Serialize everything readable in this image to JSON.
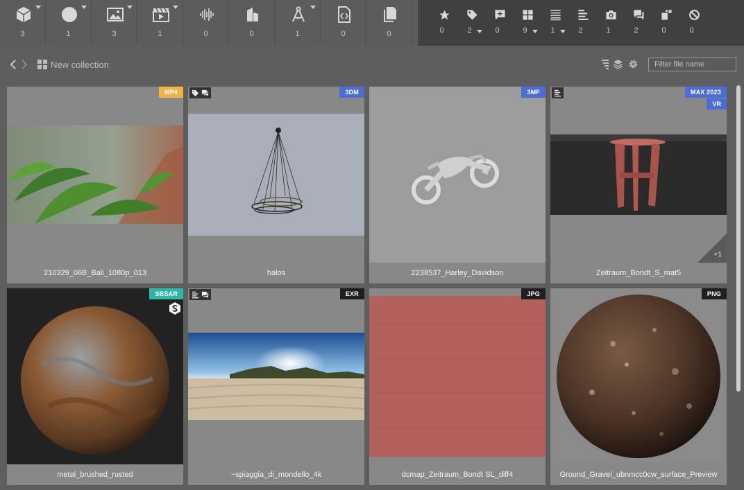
{
  "type_toolbar": [
    {
      "icon": "cube-3d-icon",
      "count": "3",
      "dropdown": true
    },
    {
      "icon": "sphere-material-icon",
      "count": "1",
      "dropdown": true
    },
    {
      "icon": "image-icon",
      "count": "3",
      "dropdown": true
    },
    {
      "icon": "video-clapper-icon",
      "count": "1",
      "dropdown": true
    },
    {
      "icon": "audio-wave-icon",
      "count": "0",
      "dropdown": false
    },
    {
      "icon": "buildings-icon",
      "count": "0",
      "dropdown": false
    },
    {
      "icon": "compass-drafting-icon",
      "count": "1",
      "dropdown": true
    },
    {
      "icon": "code-file-icon",
      "count": "0",
      "dropdown": false
    },
    {
      "icon": "documents-icon",
      "count": "0",
      "dropdown": false
    }
  ],
  "filter_toolbar": [
    {
      "icon": "star-icon",
      "count": "0",
      "dropdown": false
    },
    {
      "icon": "tag-icon",
      "count": "2",
      "dropdown": true
    },
    {
      "icon": "add-comment-icon",
      "count": "0",
      "dropdown": false
    },
    {
      "icon": "grid-layout-icon",
      "count": "9",
      "dropdown": true
    },
    {
      "icon": "list-lines-icon",
      "count": "1",
      "dropdown": true
    },
    {
      "icon": "align-left-icon",
      "count": "2",
      "dropdown": false
    },
    {
      "icon": "camera-icon",
      "count": "1",
      "dropdown": false
    },
    {
      "icon": "comments-icon",
      "count": "2",
      "dropdown": false
    },
    {
      "icon": "missing-preview-icon",
      "count": "0",
      "dropdown": false
    },
    {
      "icon": "blocked-icon",
      "count": "0",
      "dropdown": false
    }
  ],
  "path": {
    "collection_title": "New collection",
    "filter_placeholder": "Filter file name"
  },
  "colors": {
    "mp4": "#f0b443",
    "3d": "#4a6ed6",
    "sbsar": "#2fb7a6",
    "dark": "#1f1f1f"
  },
  "cards": [
    {
      "name": "210329_06B_Bali_1080p_013",
      "badge": "MP4",
      "badge_color": "#f0b443",
      "badge2": "",
      "flags": [],
      "thumb": "leaves"
    },
    {
      "name": "halos",
      "badge": "3DM",
      "badge_color": "#4a6ed6",
      "badge2": "",
      "flags": [
        "tag-icon",
        "comment-icon"
      ],
      "thumb": "chandelier"
    },
    {
      "name": "2238537_Harley_Davidson",
      "badge": "3MF",
      "badge_color": "#4a6ed6",
      "badge2": "",
      "flags": [],
      "thumb": "motorcycle"
    },
    {
      "name": "Zeitraum_Bondt_S_mat5",
      "badge": "MAX 2023",
      "badge_color": "#4a6ed6",
      "badge2": "VR",
      "flags": [
        "notes-icon"
      ],
      "thumb": "stool",
      "extra": "+1"
    },
    {
      "name": "metal_brushed_rusted",
      "badge": "SBSAR",
      "badge_color": "#2fb7a6",
      "badge2": "",
      "flags": [],
      "thumb": "rust"
    },
    {
      "name": "~spiaggia_di_mondello_4k",
      "badge": "EXR",
      "badge_color": "#1f1f1f",
      "badge2": "",
      "flags": [
        "notes-icon",
        "comment-icon"
      ],
      "thumb": "beach"
    },
    {
      "name": "dcmap_Zeitraum_Bondt SL_diff4",
      "badge": "JPG",
      "badge_color": "#1f1f1f",
      "badge2": "",
      "flags": [],
      "thumb": "red"
    },
    {
      "name": "Ground_Gravel_ubnmcc0cw_surface_Preview",
      "badge": "PNG",
      "badge_color": "#1f1f1f",
      "badge2": "",
      "flags": [],
      "thumb": "gravel"
    }
  ]
}
